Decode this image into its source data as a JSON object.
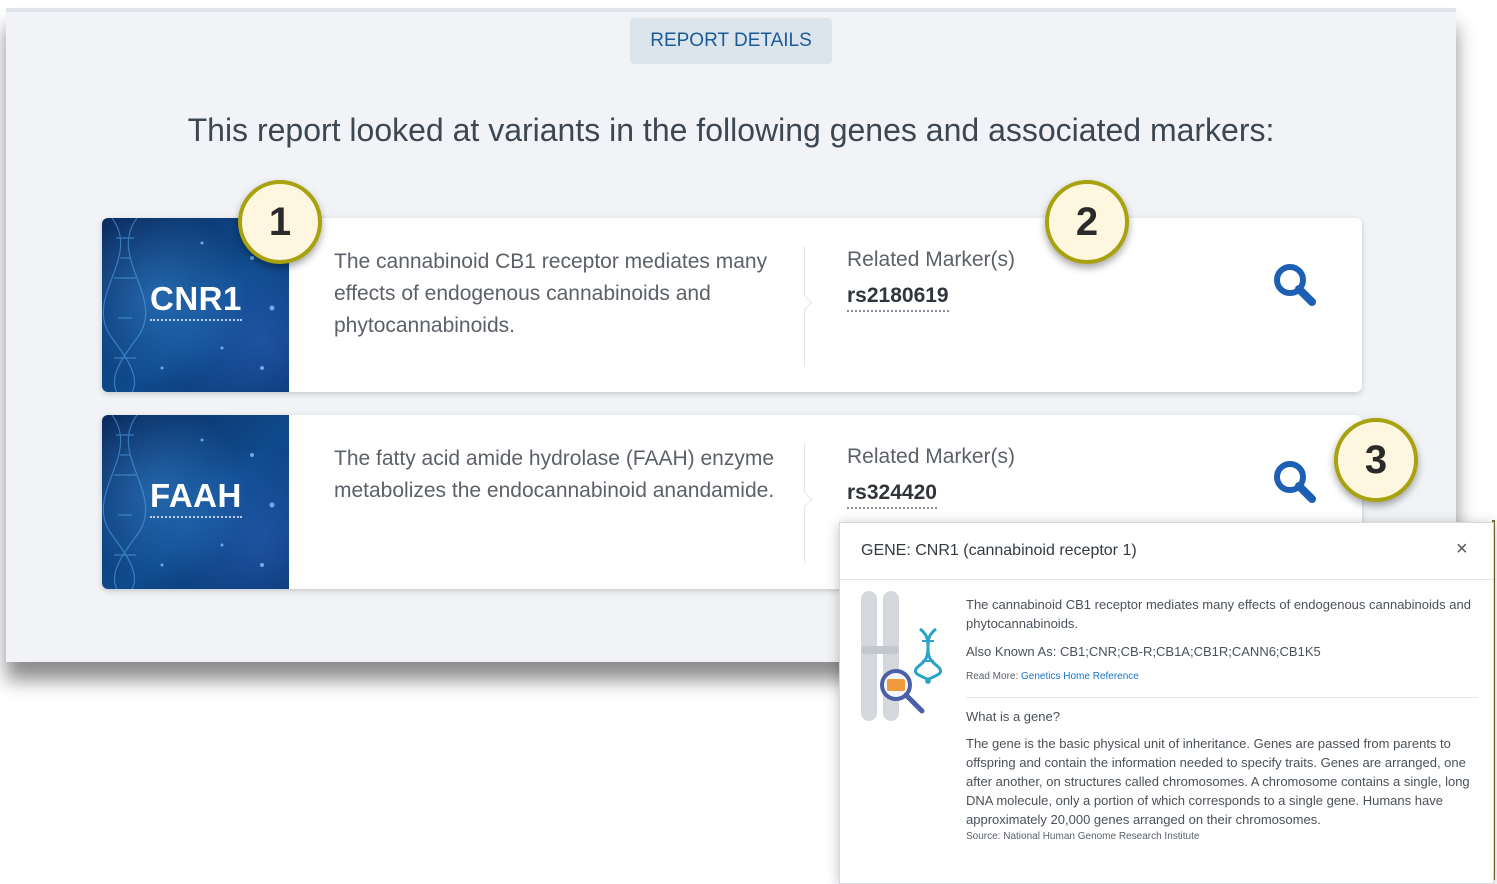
{
  "report_tab": "REPORT DETAILS",
  "intro": "This report looked at variants in the following genes and associated markers:",
  "genes": [
    {
      "symbol": "CNR1",
      "description": "The cannabinoid CB1 receptor mediates many effects of endogenous cannabinoids and phytocannabinoids.",
      "marker_label": "Related Marker(s)",
      "marker": "rs2180619"
    },
    {
      "symbol": "FAAH",
      "description": "The fatty acid amide hydrolase (FAAH) enzyme metabolizes the endocannabinoid anandamide.",
      "marker_label": "Related Marker(s)",
      "marker": "rs324420"
    }
  ],
  "callouts": [
    "1",
    "2",
    "3"
  ],
  "modal": {
    "title": "GENE: CNR1 (cannabinoid receptor 1)",
    "close": "×",
    "description": "The cannabinoid CB1 receptor mediates many effects of endogenous cannabinoids and phytocannabinoids.",
    "also_known_as": "Also Known As: CB1;CNR;CB-R;CB1A;CB1R;CANN6;CB1K5",
    "read_more_label": "Read More:",
    "read_more_link": "Genetics Home Reference",
    "question": "What is a gene?",
    "answer": "The gene is the basic physical unit of inheritance. Genes are passed from parents to offspring and contain the information needed to specify traits. Genes are arranged, one after another, on structures called chromosomes. A chromosome contains a single, long DNA molecule, only a portion of which corresponds to a single gene. Humans have approximately 20,000 genes arranged on their chromosomes.",
    "source": "Source: National Human Genome Research Institute"
  },
  "colors": {
    "accent": "#1a5a96",
    "search_icon": "#1d5fb5",
    "callout_border": "#a8a20e",
    "callout_fill": "#fff6df",
    "link": "#1a73c9"
  },
  "icons": {
    "search": "search-icon",
    "close": "close-icon",
    "gene_illustration": "chromosome-dna-magnifier-icon"
  }
}
